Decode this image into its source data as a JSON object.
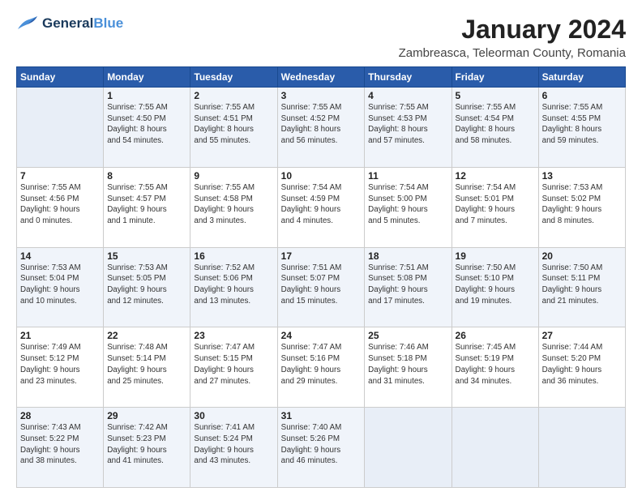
{
  "header": {
    "logo_line1": "General",
    "logo_line2": "Blue",
    "title": "January 2024",
    "subtitle": "Zambreasca, Teleorman County, Romania"
  },
  "weekdays": [
    "Sunday",
    "Monday",
    "Tuesday",
    "Wednesday",
    "Thursday",
    "Friday",
    "Saturday"
  ],
  "weeks": [
    [
      {
        "day": "",
        "info": ""
      },
      {
        "day": "1",
        "info": "Sunrise: 7:55 AM\nSunset: 4:50 PM\nDaylight: 8 hours\nand 54 minutes."
      },
      {
        "day": "2",
        "info": "Sunrise: 7:55 AM\nSunset: 4:51 PM\nDaylight: 8 hours\nand 55 minutes."
      },
      {
        "day": "3",
        "info": "Sunrise: 7:55 AM\nSunset: 4:52 PM\nDaylight: 8 hours\nand 56 minutes."
      },
      {
        "day": "4",
        "info": "Sunrise: 7:55 AM\nSunset: 4:53 PM\nDaylight: 8 hours\nand 57 minutes."
      },
      {
        "day": "5",
        "info": "Sunrise: 7:55 AM\nSunset: 4:54 PM\nDaylight: 8 hours\nand 58 minutes."
      },
      {
        "day": "6",
        "info": "Sunrise: 7:55 AM\nSunset: 4:55 PM\nDaylight: 8 hours\nand 59 minutes."
      }
    ],
    [
      {
        "day": "7",
        "info": "Sunrise: 7:55 AM\nSunset: 4:56 PM\nDaylight: 9 hours\nand 0 minutes."
      },
      {
        "day": "8",
        "info": "Sunrise: 7:55 AM\nSunset: 4:57 PM\nDaylight: 9 hours\nand 1 minute."
      },
      {
        "day": "9",
        "info": "Sunrise: 7:55 AM\nSunset: 4:58 PM\nDaylight: 9 hours\nand 3 minutes."
      },
      {
        "day": "10",
        "info": "Sunrise: 7:54 AM\nSunset: 4:59 PM\nDaylight: 9 hours\nand 4 minutes."
      },
      {
        "day": "11",
        "info": "Sunrise: 7:54 AM\nSunset: 5:00 PM\nDaylight: 9 hours\nand 5 minutes."
      },
      {
        "day": "12",
        "info": "Sunrise: 7:54 AM\nSunset: 5:01 PM\nDaylight: 9 hours\nand 7 minutes."
      },
      {
        "day": "13",
        "info": "Sunrise: 7:53 AM\nSunset: 5:02 PM\nDaylight: 9 hours\nand 8 minutes."
      }
    ],
    [
      {
        "day": "14",
        "info": "Sunrise: 7:53 AM\nSunset: 5:04 PM\nDaylight: 9 hours\nand 10 minutes."
      },
      {
        "day": "15",
        "info": "Sunrise: 7:53 AM\nSunset: 5:05 PM\nDaylight: 9 hours\nand 12 minutes."
      },
      {
        "day": "16",
        "info": "Sunrise: 7:52 AM\nSunset: 5:06 PM\nDaylight: 9 hours\nand 13 minutes."
      },
      {
        "day": "17",
        "info": "Sunrise: 7:51 AM\nSunset: 5:07 PM\nDaylight: 9 hours\nand 15 minutes."
      },
      {
        "day": "18",
        "info": "Sunrise: 7:51 AM\nSunset: 5:08 PM\nDaylight: 9 hours\nand 17 minutes."
      },
      {
        "day": "19",
        "info": "Sunrise: 7:50 AM\nSunset: 5:10 PM\nDaylight: 9 hours\nand 19 minutes."
      },
      {
        "day": "20",
        "info": "Sunrise: 7:50 AM\nSunset: 5:11 PM\nDaylight: 9 hours\nand 21 minutes."
      }
    ],
    [
      {
        "day": "21",
        "info": "Sunrise: 7:49 AM\nSunset: 5:12 PM\nDaylight: 9 hours\nand 23 minutes."
      },
      {
        "day": "22",
        "info": "Sunrise: 7:48 AM\nSunset: 5:14 PM\nDaylight: 9 hours\nand 25 minutes."
      },
      {
        "day": "23",
        "info": "Sunrise: 7:47 AM\nSunset: 5:15 PM\nDaylight: 9 hours\nand 27 minutes."
      },
      {
        "day": "24",
        "info": "Sunrise: 7:47 AM\nSunset: 5:16 PM\nDaylight: 9 hours\nand 29 minutes."
      },
      {
        "day": "25",
        "info": "Sunrise: 7:46 AM\nSunset: 5:18 PM\nDaylight: 9 hours\nand 31 minutes."
      },
      {
        "day": "26",
        "info": "Sunrise: 7:45 AM\nSunset: 5:19 PM\nDaylight: 9 hours\nand 34 minutes."
      },
      {
        "day": "27",
        "info": "Sunrise: 7:44 AM\nSunset: 5:20 PM\nDaylight: 9 hours\nand 36 minutes."
      }
    ],
    [
      {
        "day": "28",
        "info": "Sunrise: 7:43 AM\nSunset: 5:22 PM\nDaylight: 9 hours\nand 38 minutes."
      },
      {
        "day": "29",
        "info": "Sunrise: 7:42 AM\nSunset: 5:23 PM\nDaylight: 9 hours\nand 41 minutes."
      },
      {
        "day": "30",
        "info": "Sunrise: 7:41 AM\nSunset: 5:24 PM\nDaylight: 9 hours\nand 43 minutes."
      },
      {
        "day": "31",
        "info": "Sunrise: 7:40 AM\nSunset: 5:26 PM\nDaylight: 9 hours\nand 46 minutes."
      },
      {
        "day": "",
        "info": ""
      },
      {
        "day": "",
        "info": ""
      },
      {
        "day": "",
        "info": ""
      }
    ]
  ]
}
